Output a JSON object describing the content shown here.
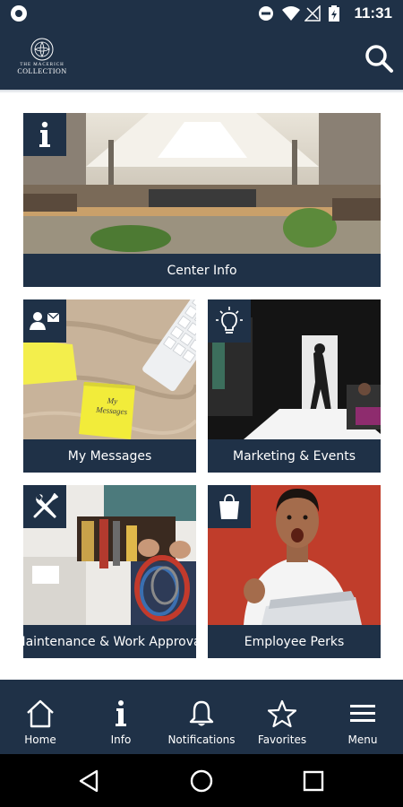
{
  "status_bar": {
    "time": "11:31"
  },
  "app_bar": {
    "logo_small": "THE MACERICH",
    "logo_text": "COLLECTION"
  },
  "tiles": [
    {
      "label": "Center Info",
      "icon": "info-icon"
    },
    {
      "label": "My Messages",
      "icon": "contact-mail-icon",
      "note_text": "My Messages"
    },
    {
      "label": "Marketing & Events",
      "icon": "lightbulb-icon"
    },
    {
      "label": "Maintenance & Work Approval",
      "icon": "tools-icon"
    },
    {
      "label": "Employee Perks",
      "icon": "shopping-bag-icon"
    }
  ],
  "bottom_nav": [
    {
      "label": "Home",
      "icon": "home-icon"
    },
    {
      "label": "Info",
      "icon": "info-icon"
    },
    {
      "label": "Notifications",
      "icon": "bell-icon"
    },
    {
      "label": "Favorites",
      "icon": "star-icon"
    },
    {
      "label": "Menu",
      "icon": "hamburger-menu-icon"
    }
  ],
  "colors": {
    "navy": "#1f3147",
    "white": "#ffffff"
  }
}
